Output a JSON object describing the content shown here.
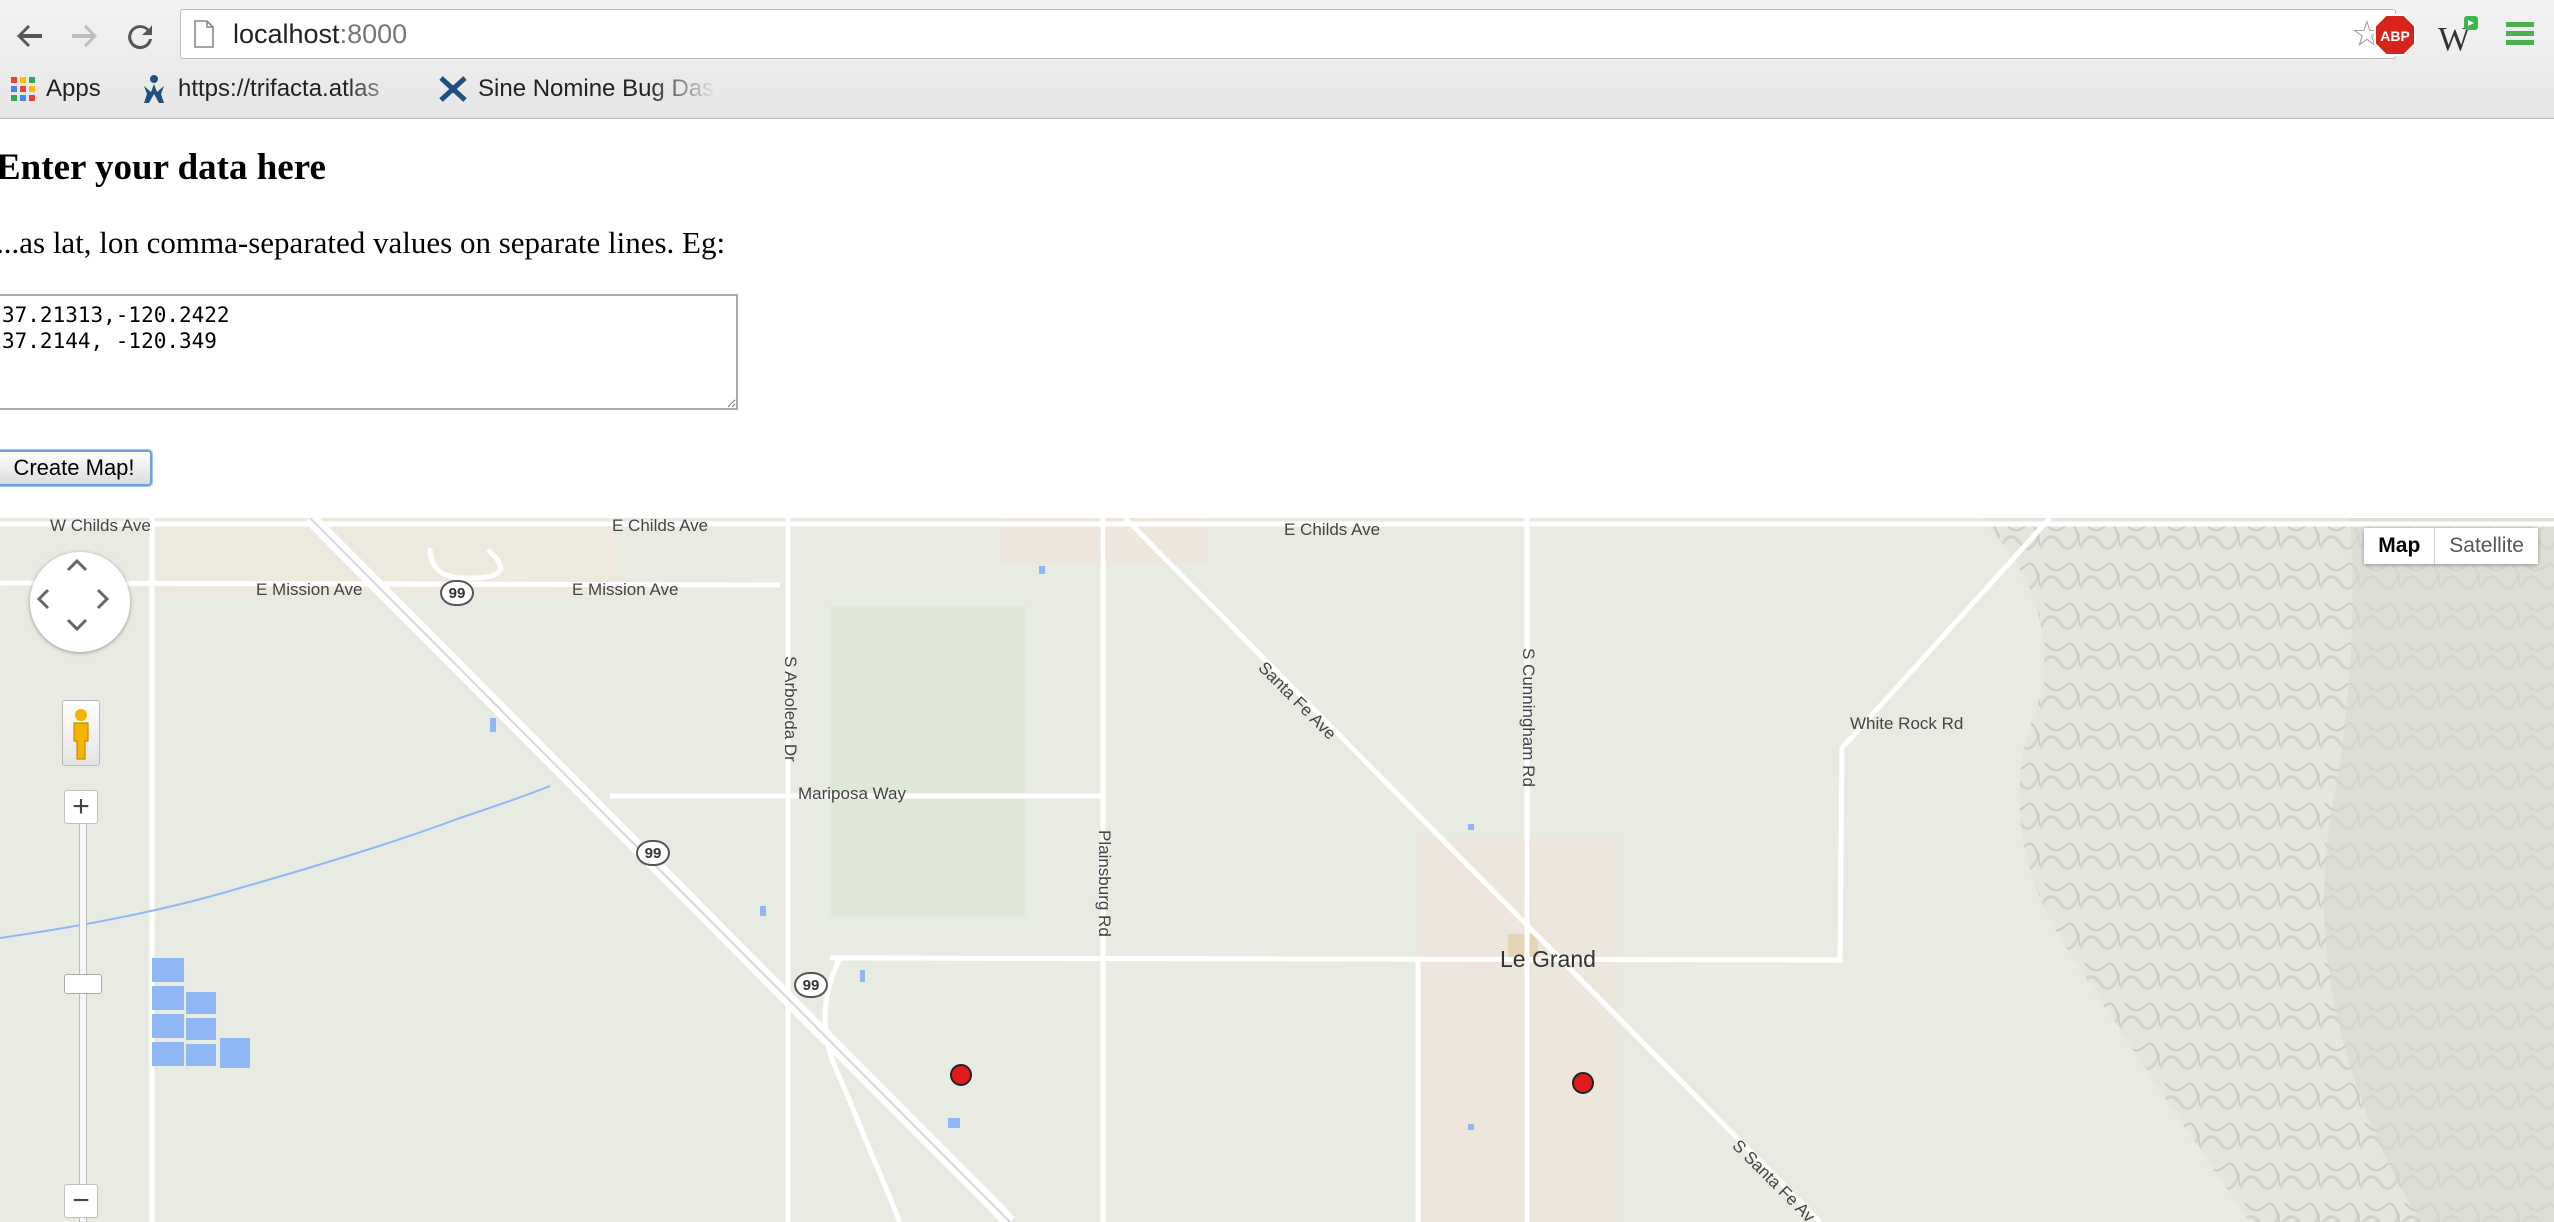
{
  "browser": {
    "url_host": "localhost",
    "url_port": ":8000",
    "bookmarks": [
      {
        "label": "Apps",
        "icon": "apps-grid-icon"
      },
      {
        "label": "https://trifacta.atlas",
        "icon": "jira-icon"
      },
      {
        "label": "Sine Nomine Bug Das",
        "icon": "bug-dashboard-icon"
      }
    ],
    "extensions": {
      "adblock_label": "ABP"
    }
  },
  "page": {
    "heading": "Enter your data here",
    "description": "...as lat, lon comma-separated values on separate lines. Eg:",
    "textarea_value": "37.21313,-120.2422\n37.2144, -120.349",
    "button_label": "Create Map!"
  },
  "map": {
    "type_controls": [
      "Map",
      "Satellite"
    ],
    "active_type": "Map",
    "zoom_in_label": "+",
    "zoom_out_label": "−",
    "labels": {
      "w_childs_ave": "W Childs Ave",
      "e_childs_ave_1": "E Childs Ave",
      "e_childs_ave_2": "E Childs Ave",
      "e_mission_ave_1": "E Mission Ave",
      "e_mission_ave_2": "E Mission Ave",
      "s_arboleda_dr": "S Arboleda Dr",
      "mariposa_way": "Mariposa Way",
      "plainsburg_rd": "Plainsburg Rd",
      "santa_fe_ave": "Santa Fe Ave",
      "s_cunningham_rd": "S Cunningham Rd",
      "white_rock_rd": "White Rock Rd",
      "le_grand": "Le Grand",
      "s_santa_fe_av": "S Santa Fe Av"
    },
    "highway_shields": [
      "99",
      "99",
      "99"
    ],
    "markers": [
      {
        "lat": 37.21313,
        "lon": -120.2422
      },
      {
        "lat": 37.2144,
        "lon": -120.349
      }
    ],
    "marker_color": "#e31a1c",
    "water_color": "#8fb6f5",
    "land_color": "#e8ebe2",
    "town_color": "#ece6dc"
  }
}
